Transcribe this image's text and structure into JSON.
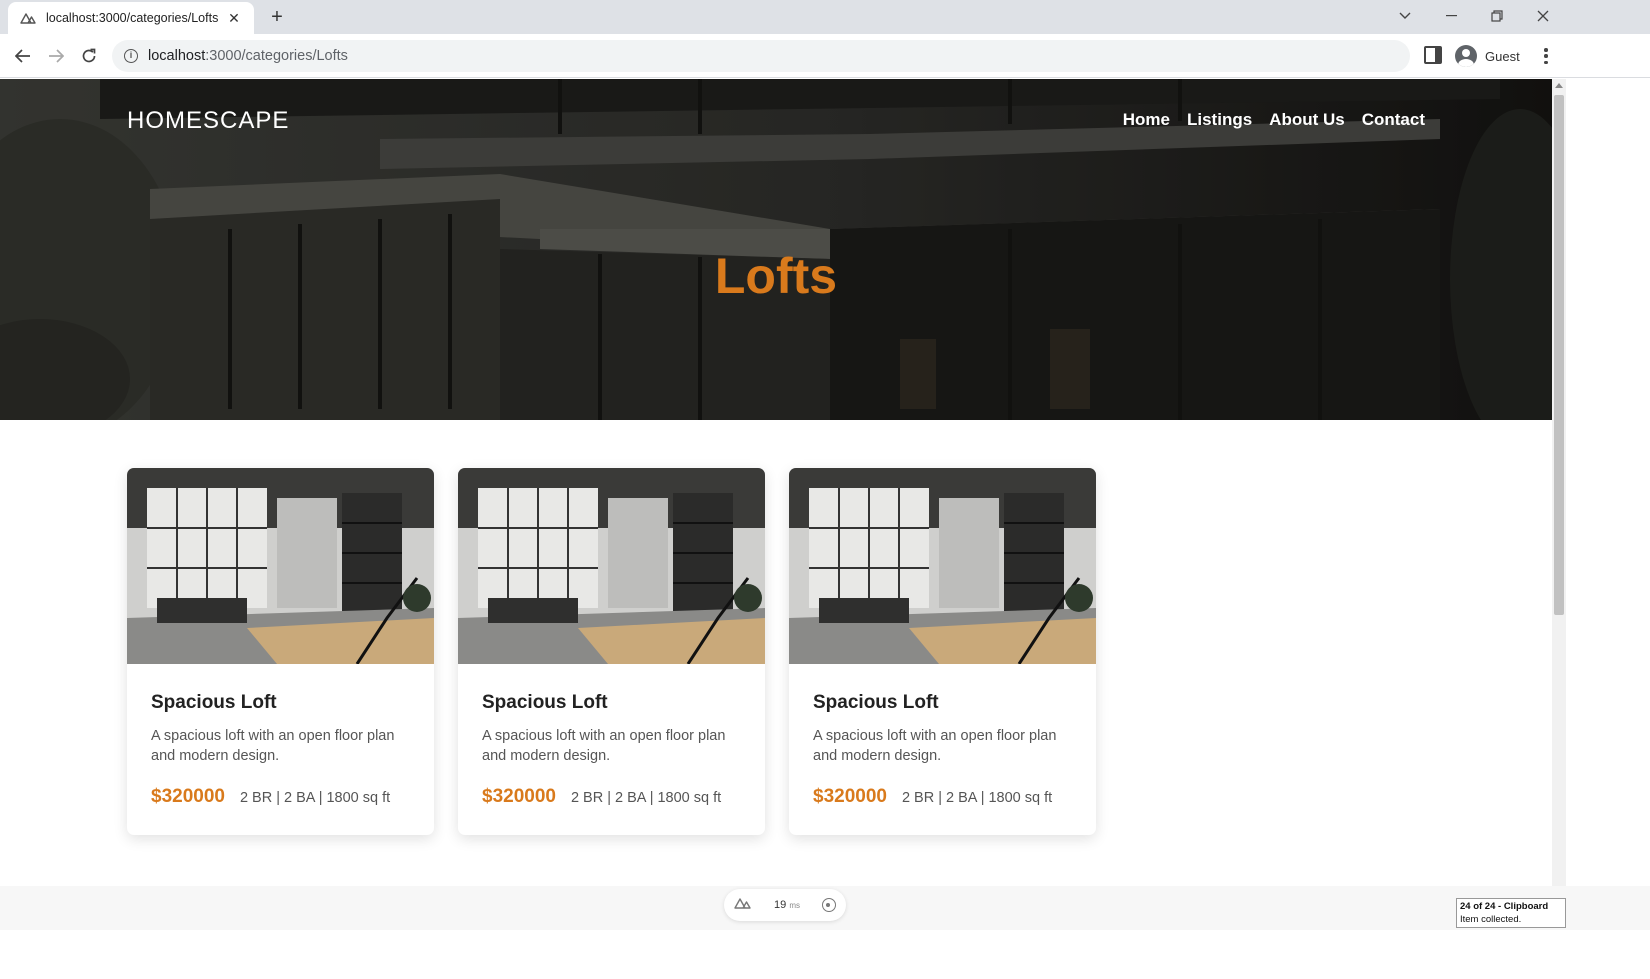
{
  "browser": {
    "tab_title": "localhost:3000/categories/Lofts",
    "url_host": "localhost",
    "url_path": ":3000/categories/Lofts",
    "profile_name": "Guest"
  },
  "site": {
    "brand": "HOMESCAPE",
    "nav": [
      "Home",
      "Listings",
      "About Us",
      "Contact"
    ],
    "hero_title": "Lofts",
    "accent_color": "#d97a1c"
  },
  "listings": [
    {
      "title": "Spacious Loft",
      "description": "A spacious loft with an open floor plan and modern design.",
      "price": "$320000",
      "specs": "2 BR | 2 BA | 1800 sq ft"
    },
    {
      "title": "Spacious Loft",
      "description": "A spacious loft with an open floor plan and modern design.",
      "price": "$320000",
      "specs": "2 BR | 2 BA | 1800 sq ft"
    },
    {
      "title": "Spacious Loft",
      "description": "A spacious loft with an open floor plan and modern design.",
      "price": "$320000",
      "specs": "2 BR | 2 BA | 1800 sq ft"
    }
  ],
  "devtools": {
    "timing": "19",
    "unit": "ms"
  },
  "clipboard": {
    "line1": "24 of 24 - Clipboard",
    "line2": "Item collected."
  }
}
